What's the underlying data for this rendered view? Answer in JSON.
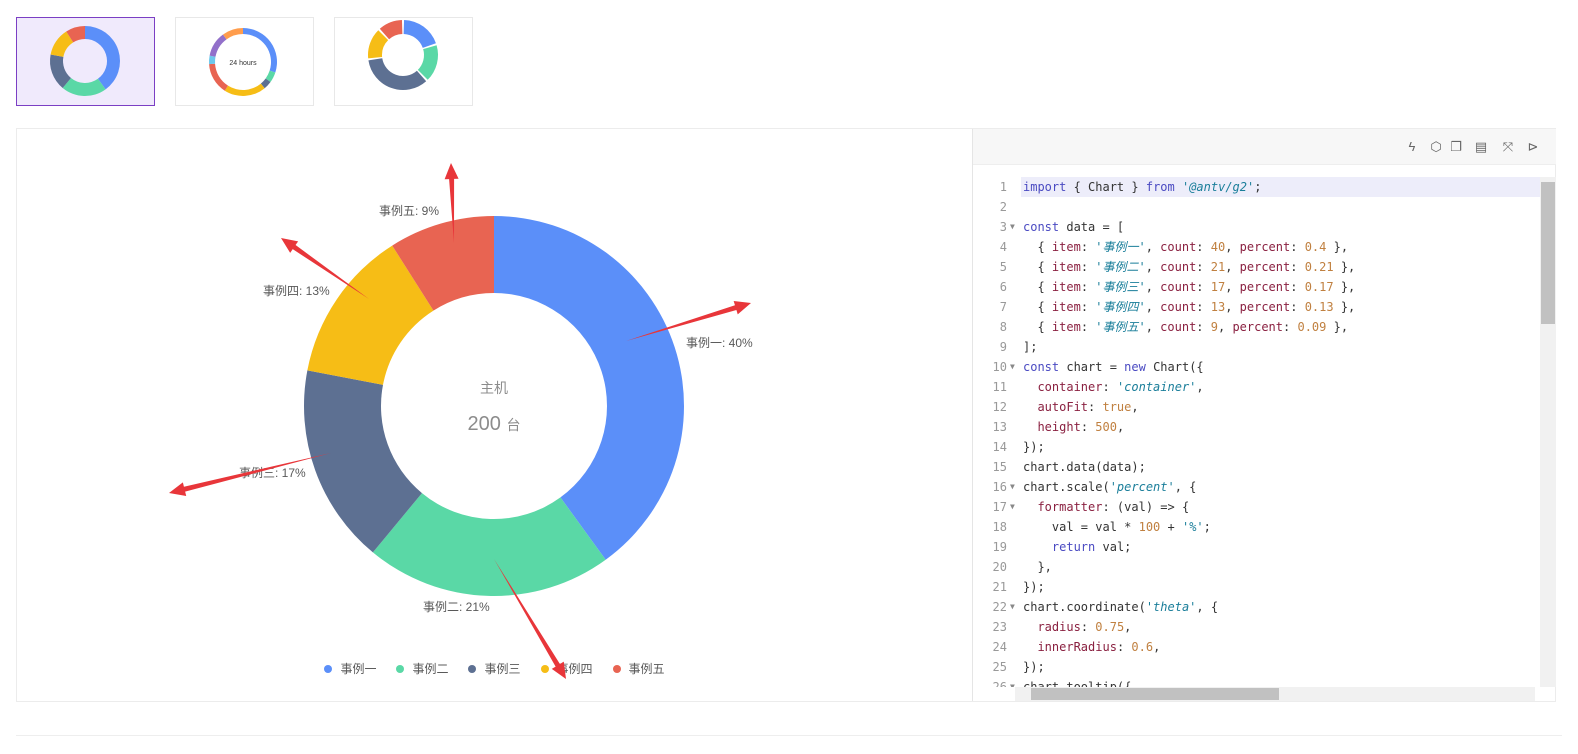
{
  "thumbnails": [
    {
      "name": "donut-with-center-text",
      "active": true
    },
    {
      "name": "24-hours-donut",
      "center": "24 hours",
      "active": false
    },
    {
      "name": "spaced-donut",
      "active": false
    }
  ],
  "toolbar": {
    "icons": [
      "lightning-icon",
      "codesandbox-icon",
      "copy-icon",
      "html-icon",
      "fullscreen-icon",
      "play-icon"
    ]
  },
  "chart_data": {
    "type": "pie",
    "variant": "donut",
    "categories": [
      "事例一",
      "事例二",
      "事例三",
      "事例四",
      "事例五"
    ],
    "values": [
      40,
      21,
      17,
      13,
      9
    ],
    "percent": [
      0.4,
      0.21,
      0.17,
      0.13,
      0.09
    ],
    "labels": [
      "事例一: 40%",
      "事例二: 21%",
      "事例三: 17%",
      "事例四: 13%",
      "事例五: 9%"
    ],
    "colors": [
      "#5B8FF9",
      "#5AD8A6",
      "#5D7092",
      "#F6BD16",
      "#E86452"
    ],
    "center_title": "主机",
    "center_value": "200",
    "center_unit": "台",
    "legend_position": "bottom",
    "annotation_arrow_color": "#E8363A"
  },
  "code": {
    "lines": [
      "import { Chart } from '@antv/g2';",
      "",
      "const data = [",
      "  { item: '事例一', count: 40, percent: 0.4 },",
      "  { item: '事例二', count: 21, percent: 0.21 },",
      "  { item: '事例三', count: 17, percent: 0.17 },",
      "  { item: '事例四', count: 13, percent: 0.13 },",
      "  { item: '事例五', count: 9, percent: 0.09 },",
      "];",
      "const chart = new Chart({",
      "  container: 'container',",
      "  autoFit: true,",
      "  height: 500,",
      "});",
      "chart.data(data);",
      "chart.scale('percent', {",
      "  formatter: (val) => {",
      "    val = val * 100 + '%';",
      "    return val;",
      "  },",
      "});",
      "chart.coordinate('theta', {",
      "  radius: 0.75,",
      "  innerRadius: 0.6,",
      "});",
      "chart.tooltip({",
      ""
    ],
    "folds": [
      3,
      10,
      16,
      17,
      22,
      26
    ]
  }
}
